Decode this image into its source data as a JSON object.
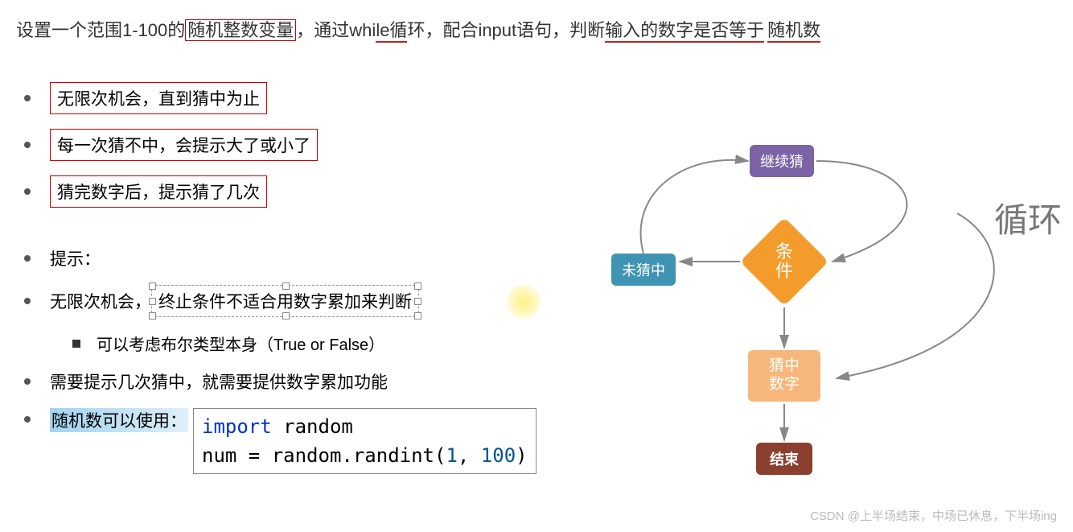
{
  "header": {
    "part1": "设置一个范围1-100的",
    "box1": "随机整数变量",
    "part2": "，通过whi",
    "underline1": "le循",
    "part3": "环，配合input语句，判断",
    "underline2": "输入的数字是否等于",
    "underline3": "随机数"
  },
  "bullets_boxed": [
    "无限次机会，直到猜中为止",
    "每一次猜不中，会提示大了或小了",
    "猜完数字后，提示猜了几次"
  ],
  "hint_label": "提示：",
  "bullet_inf_prefix": "无限次机会，",
  "bullet_inf_dashed": "终止条件不适合用数字累加来判断",
  "sub_bullet": "可以考虑布尔类型本身（True or False）",
  "bullet_need": "需要提示几次猜中，就需要提供数字累加功能",
  "bullet_random_prefix": "随机数可以使用：",
  "code": {
    "line1_import": "import",
    "line1_rest": " random",
    "line2_pre": "num = random.randint(",
    "line2_a": "1",
    "line2_mid": ", ",
    "line2_b": "100",
    "line2_end": ")"
  },
  "flow": {
    "continue": "继续猜",
    "condition_l1": "条",
    "condition_l2": "件",
    "not_guessed": "未猜中",
    "guessed_l1": "猜中",
    "guessed_l2": "数字",
    "end": "结束",
    "loop_label": "循环"
  },
  "watermark": "CSDN @上半场结束，中场已休息，下半场ing"
}
